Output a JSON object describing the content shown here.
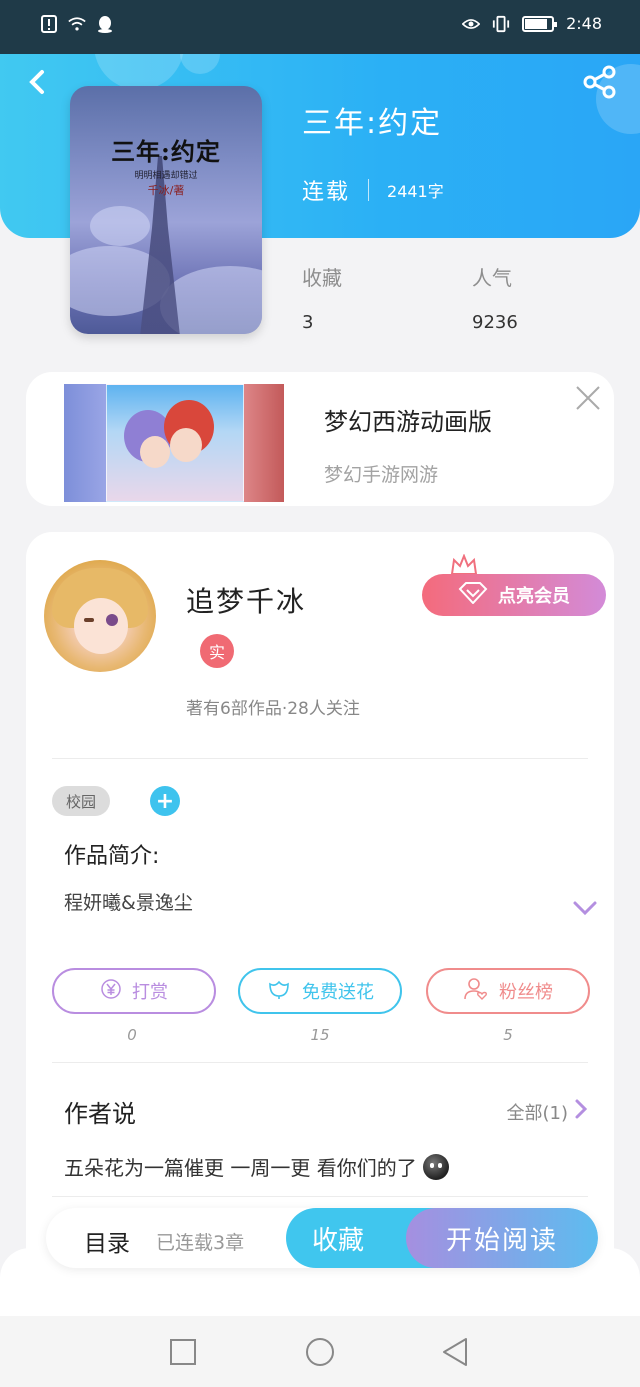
{
  "status_bar": {
    "time": "2:48",
    "battery_level": 0.8
  },
  "book": {
    "title": "三年:约定",
    "status": "连载",
    "word_count": "2441字",
    "cover_title": "三年:约定",
    "cover_subtitle": "明明相遇却错过",
    "cover_author": "千冰/著",
    "stats": [
      {
        "label": "收藏",
        "value": "3"
      },
      {
        "label": "人气",
        "value": "9236"
      }
    ]
  },
  "ad": {
    "title": "梦幻西游动画版",
    "subtitle": "梦幻手游网游"
  },
  "author": {
    "name": "追梦千冰",
    "real_badge": "实",
    "vip_label": "点亮会员",
    "meta": "著有6部作品·28人关注"
  },
  "tags": [
    "校园"
  ],
  "intro": {
    "label": "作品简介:",
    "text": "程妍曦&景逸尘"
  },
  "actions": [
    {
      "label": "打赏",
      "count": "0",
      "color": "#b98de0"
    },
    {
      "label": "免费送花",
      "count": "15",
      "color": "#40c4ec"
    },
    {
      "label": "粉丝榜",
      "count": "5",
      "color": "#f08c8c"
    }
  ],
  "author_says": {
    "title": "作者说",
    "all_label": "全部(1)",
    "text": "五朵花为一篇催更  一周一更 看你们的了"
  },
  "bottom_bar": {
    "toc_label": "目录",
    "progress": "已连载3章",
    "favorite_label": "收藏",
    "read_label": "开始阅读"
  },
  "colors": {
    "accent": "#2bb0f5",
    "vip_start": "#f46b7c",
    "vip_end": "#d38bd8"
  }
}
